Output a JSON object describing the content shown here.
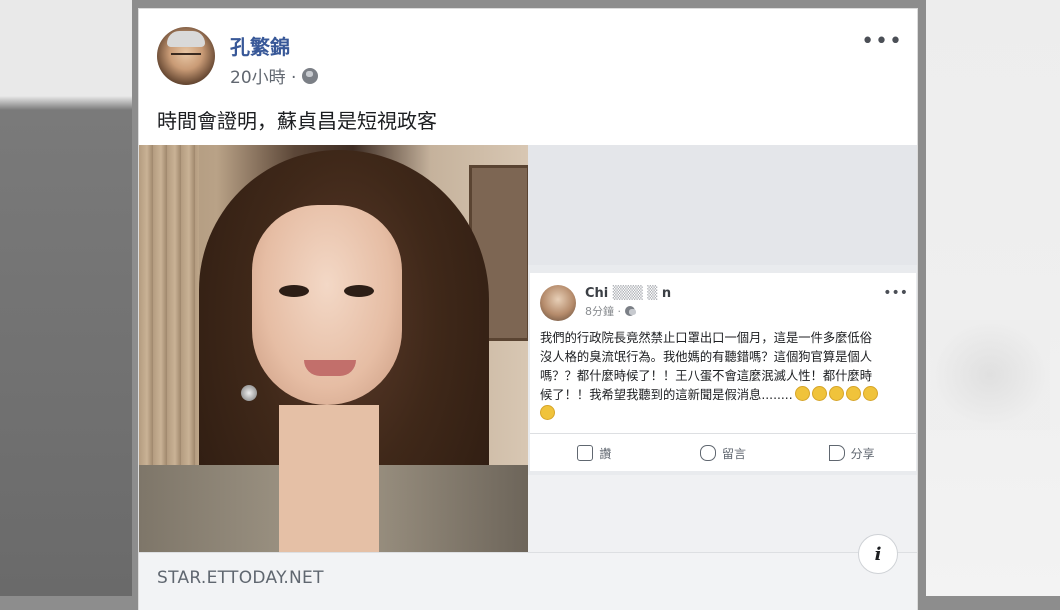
{
  "post": {
    "author_name": "孔繁錦",
    "timestamp": "20小時 ·",
    "privacy_icon": "globe-icon",
    "body_text": "時間會證明，蘇貞昌是短視政客",
    "more_icon": "•••"
  },
  "embedded_post": {
    "author_name": "Chi",
    "author_name_tail": "n",
    "timestamp": "8分鐘 ·",
    "more_icon": "•••",
    "text_line1": "我們的行政院長竟然禁止口罩出口一個月，這是一件多麼低俗",
    "text_line2": "沒人格的臭流氓行為。我他媽的有聽錯嗎？這個狗官算是個人",
    "text_line3": "嗎？？都什麼時候了！！王八蛋不會這麼泯滅人性！都什麼時",
    "text_line4": "候了！！我希望我聽到的這新聞是假消息........",
    "emoji_name": "disappointed-face-icon",
    "actions": {
      "like": "讚",
      "comment": "留言",
      "share": "分享"
    }
  },
  "link_preview": {
    "domain": "STAR.ETTODAY.NET",
    "info_icon": "i"
  },
  "colors": {
    "author_link": "#385898",
    "meta_gray": "#616770",
    "domain_bar": "#f2f3f5"
  }
}
